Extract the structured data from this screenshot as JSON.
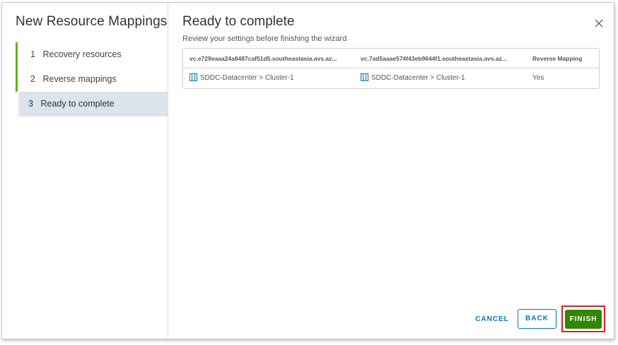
{
  "sidebar": {
    "title": "New Resource Mappings",
    "steps": [
      {
        "num": "1",
        "label": "Recovery resources"
      },
      {
        "num": "2",
        "label": "Reverse mappings"
      },
      {
        "num": "3",
        "label": "Ready to complete"
      }
    ]
  },
  "main": {
    "title": "Ready to complete",
    "subtitle": "Review your settings before finishing the wizard",
    "table": {
      "headers": [
        "vc.e729eaaa24a8487caf51d5.southeastasia.avs.az...",
        "vc.7ad5aaae574f43eb9644f1.southeastasia.avs.az...",
        "Reverse Mapping"
      ],
      "rows": [
        [
          "SDDC-Datacenter > Cluster-1",
          "SDDC-Datacenter > Cluster-1",
          "Yes"
        ]
      ]
    }
  },
  "footer": {
    "cancel_label": "CANCEL",
    "back_label": "BACK",
    "finish_label": "FINISH"
  },
  "colors": {
    "accent": "#0079b8",
    "success": "#318700",
    "progress": "#60b515",
    "highlight": "#e02020"
  },
  "icons": {
    "close": "close-icon",
    "cluster": "cluster-icon"
  }
}
